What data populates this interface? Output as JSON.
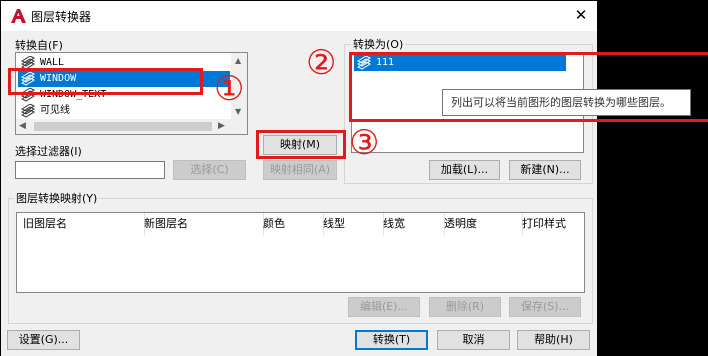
{
  "dialog": {
    "title": "图层转换器",
    "close_glyph": "✕"
  },
  "convert_from": {
    "label": "转换自(F)",
    "items": [
      "WALL",
      "WINDOW",
      "WINDOW_TEXT",
      "可见线"
    ],
    "selected": "WINDOW"
  },
  "selection_filter": {
    "label": "选择过滤器(I)",
    "value": "",
    "select_button": "选择(C)"
  },
  "map_buttons": {
    "map": "映射(M)",
    "map_same": "映射相同(A)"
  },
  "convert_to": {
    "label": "转换为(O)",
    "items": [
      "111"
    ],
    "tooltip": "列出可以将当前图形的图层转换为哪些图层。",
    "load_button": "加载(L)...",
    "new_button": "新建(N)..."
  },
  "mappings": {
    "label": "图层转换映射(Y)",
    "columns": [
      "旧图层名",
      "新图层名",
      "颜色",
      "线型",
      "线宽",
      "透明度",
      "打印样式"
    ],
    "edit_button": "编辑(E)...",
    "delete_button": "删除(R)",
    "save_button": "保存(S)..."
  },
  "footer": {
    "settings_button": "设置(G)...",
    "convert_button": "转换(T)",
    "cancel_button": "取消",
    "help_button": "帮助(H)"
  },
  "annotations": [
    "①",
    "②",
    "③"
  ],
  "colors": {
    "highlight": "#0078d7",
    "annotation_red": "#e11b1b",
    "app_logo_red": "#c8102e"
  }
}
